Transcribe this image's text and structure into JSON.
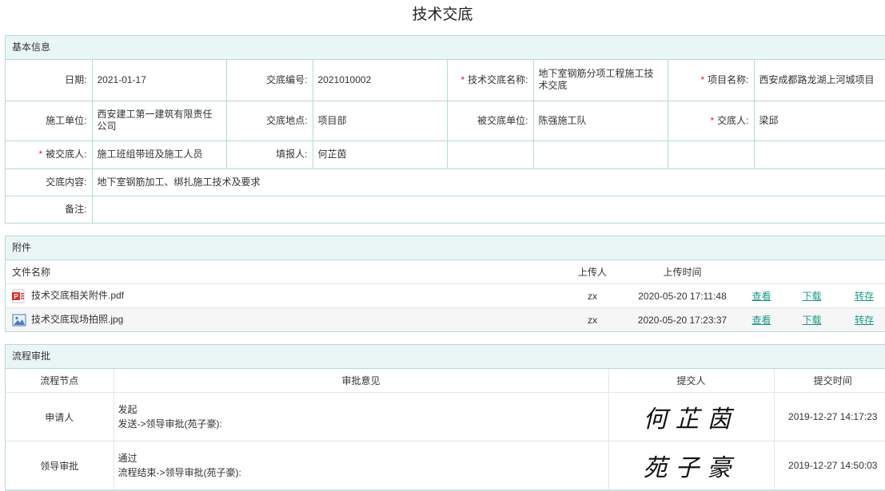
{
  "title": "技术交底",
  "basic": {
    "header": "基本信息",
    "date_label": "日期:",
    "date": "2021-01-17",
    "code_label": "交底编号:",
    "code": "2021010002",
    "name_label": "技术交底名称:",
    "name": "地下室钢筋分项工程施工技术交底",
    "project_label": "项目名称:",
    "project": "西安成都路龙湖上河城项目",
    "unit_label": "施工单位:",
    "unit": "西安建工第一建筑有限责任公司",
    "place_label": "交底地点:",
    "place": "项目部",
    "receiver_unit_label": "被交底单位:",
    "receiver_unit": "陈强施工队",
    "discloser_label": "交底人:",
    "discloser": "梁邱",
    "receiver_label": "被交底人:",
    "receiver": "施工班组带班及施工人员",
    "filler_label": "填报人:",
    "filler": "何芷茵",
    "content_label": "交底内容:",
    "content": "地下室钢筋加工、绑扎施工技术及要求",
    "remark_label": "备注:",
    "remark": ""
  },
  "attachments": {
    "header": "附件",
    "col_name": "文件名称",
    "col_uploader": "上传人",
    "col_time": "上传时间",
    "files": [
      {
        "name": "技术交底相关附件.pdf",
        "icon": "pdf-icon",
        "uploader": "zx",
        "time": "2020-05-20 17:11:48",
        "view": "查看",
        "download": "下载",
        "save": "转存"
      },
      {
        "name": "技术交底现场拍照.jpg",
        "icon": "image-icon",
        "uploader": "zx",
        "time": "2020-05-20 17:23:37",
        "view": "查看",
        "download": "下载",
        "save": "转存"
      }
    ]
  },
  "flow": {
    "header": "流程审批",
    "col_node": "流程节点",
    "col_opinion": "审批意见",
    "col_submitter": "提交人",
    "col_time": "提交时间",
    "rows": [
      {
        "node": "申请人",
        "opinion_1": "发起",
        "opinion_2": "发送->领导审批(苑子豪):",
        "signature": "何芷茵",
        "time": "2019-12-27 14:17:23"
      },
      {
        "node": "领导审批",
        "opinion_1": "通过",
        "opinion_2": "流程结束->领导审批(苑子豪):",
        "signature": "苑子豪",
        "time": "2019-12-27 14:50:03"
      }
    ]
  }
}
